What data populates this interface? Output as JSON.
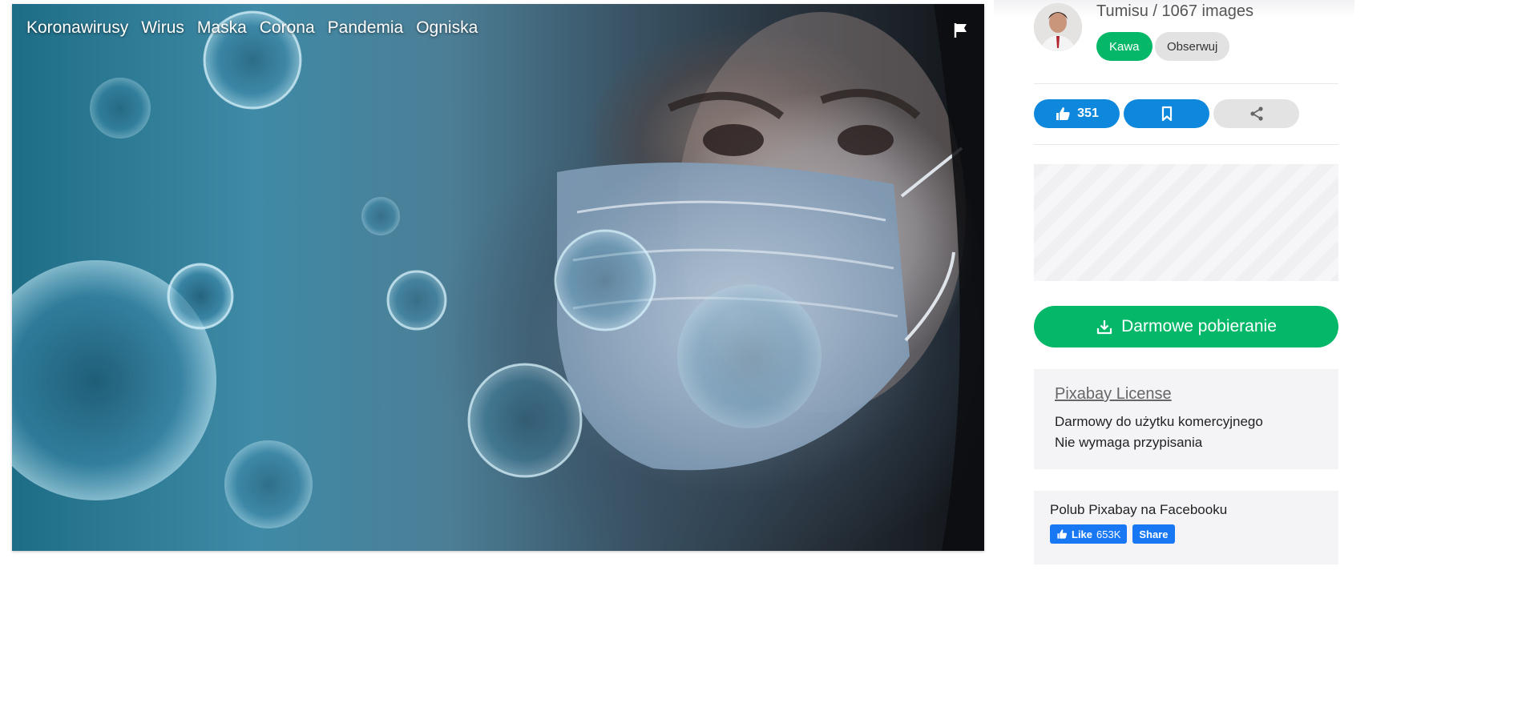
{
  "image": {
    "tags": [
      "Koronawirusy",
      "Wirus",
      "Maska",
      "Corona",
      "Pandemia",
      "Ogniska"
    ],
    "flag_icon": "flag-icon",
    "description": ""
  },
  "author": {
    "name": "Tumisu",
    "separator": " / ",
    "image_count": "1067 images",
    "coffee_label": "Kawa",
    "follow_label": "Obserwuj"
  },
  "actions": {
    "like_count": "351",
    "like_icon": "thumbs-up-icon",
    "save_icon": "bookmark-icon",
    "share_icon": "share-icon"
  },
  "download": {
    "label": "Darmowe pobieranie",
    "icon": "download-icon"
  },
  "license": {
    "title": "Pixabay License",
    "line1": "Darmowy do użytku komercyjnego",
    "line2": "Nie wymaga przypisania"
  },
  "facebook": {
    "title": "Polub Pixabay na Facebooku",
    "like_label": "Like",
    "like_count": "653K",
    "share_label": "Share"
  },
  "colors": {
    "green": "#05b869",
    "blue": "#0e88dd",
    "facebook": "#1877f2"
  }
}
